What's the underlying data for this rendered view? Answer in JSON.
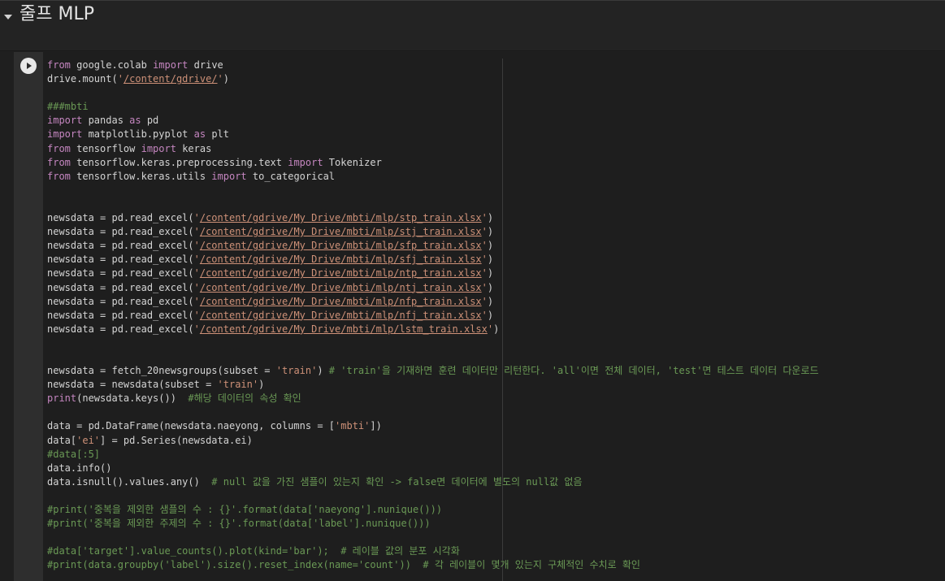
{
  "section": {
    "title": "줄프 MLP",
    "collapse_icon": "caret-down-icon"
  },
  "cell": {
    "run_icon": "play-icon",
    "lines": [
      [
        {
          "t": "kw",
          "v": "from"
        },
        {
          "t": "plain",
          "v": " google.colab "
        },
        {
          "t": "kw",
          "v": "import"
        },
        {
          "t": "plain",
          "v": " drive"
        }
      ],
      [
        {
          "t": "plain",
          "v": "drive.mount("
        },
        {
          "t": "str",
          "v": "'"
        },
        {
          "t": "link",
          "v": "/content/gdrive/"
        },
        {
          "t": "str",
          "v": "'"
        },
        {
          "t": "plain",
          "v": ")"
        }
      ],
      [],
      [
        {
          "t": "cmt",
          "v": "###mbti"
        }
      ],
      [
        {
          "t": "kw",
          "v": "import"
        },
        {
          "t": "plain",
          "v": " pandas "
        },
        {
          "t": "kw",
          "v": "as"
        },
        {
          "t": "plain",
          "v": " pd"
        }
      ],
      [
        {
          "t": "kw",
          "v": "import"
        },
        {
          "t": "plain",
          "v": " matplotlib.pyplot "
        },
        {
          "t": "kw",
          "v": "as"
        },
        {
          "t": "plain",
          "v": " plt"
        }
      ],
      [
        {
          "t": "kw",
          "v": "from"
        },
        {
          "t": "plain",
          "v": " tensorflow "
        },
        {
          "t": "kw",
          "v": "import"
        },
        {
          "t": "plain",
          "v": " keras"
        }
      ],
      [
        {
          "t": "kw",
          "v": "from"
        },
        {
          "t": "plain",
          "v": " tensorflow.keras.preprocessing.text "
        },
        {
          "t": "kw",
          "v": "import"
        },
        {
          "t": "plain",
          "v": " Tokenizer"
        }
      ],
      [
        {
          "t": "kw",
          "v": "from"
        },
        {
          "t": "plain",
          "v": " tensorflow.keras.utils "
        },
        {
          "t": "kw",
          "v": "import"
        },
        {
          "t": "plain",
          "v": " to_categorical"
        }
      ],
      [],
      [],
      [
        {
          "t": "plain",
          "v": "newsdata = pd.read_excel("
        },
        {
          "t": "str",
          "v": "'"
        },
        {
          "t": "link",
          "v": "/content/gdrive/My Drive/mbti/mlp/stp_train.xlsx"
        },
        {
          "t": "str",
          "v": "'"
        },
        {
          "t": "plain",
          "v": ")"
        }
      ],
      [
        {
          "t": "plain",
          "v": "newsdata = pd.read_excel("
        },
        {
          "t": "str",
          "v": "'"
        },
        {
          "t": "link",
          "v": "/content/gdrive/My Drive/mbti/mlp/stj_train.xlsx"
        },
        {
          "t": "str",
          "v": "'"
        },
        {
          "t": "plain",
          "v": ")"
        }
      ],
      [
        {
          "t": "plain",
          "v": "newsdata = pd.read_excel("
        },
        {
          "t": "str",
          "v": "'"
        },
        {
          "t": "link",
          "v": "/content/gdrive/My Drive/mbti/mlp/sfp_train.xlsx"
        },
        {
          "t": "str",
          "v": "'"
        },
        {
          "t": "plain",
          "v": ")"
        }
      ],
      [
        {
          "t": "plain",
          "v": "newsdata = pd.read_excel("
        },
        {
          "t": "str",
          "v": "'"
        },
        {
          "t": "link",
          "v": "/content/gdrive/My Drive/mbti/mlp/sfj_train.xlsx"
        },
        {
          "t": "str",
          "v": "'"
        },
        {
          "t": "plain",
          "v": ")"
        }
      ],
      [
        {
          "t": "plain",
          "v": "newsdata = pd.read_excel("
        },
        {
          "t": "str",
          "v": "'"
        },
        {
          "t": "link",
          "v": "/content/gdrive/My Drive/mbti/mlp/ntp_train.xlsx"
        },
        {
          "t": "str",
          "v": "'"
        },
        {
          "t": "plain",
          "v": ")"
        }
      ],
      [
        {
          "t": "plain",
          "v": "newsdata = pd.read_excel("
        },
        {
          "t": "str",
          "v": "'"
        },
        {
          "t": "link",
          "v": "/content/gdrive/My Drive/mbti/mlp/ntj_train.xlsx"
        },
        {
          "t": "str",
          "v": "'"
        },
        {
          "t": "plain",
          "v": ")"
        }
      ],
      [
        {
          "t": "plain",
          "v": "newsdata = pd.read_excel("
        },
        {
          "t": "str",
          "v": "'"
        },
        {
          "t": "link",
          "v": "/content/gdrive/My Drive/mbti/mlp/nfp_train.xlsx"
        },
        {
          "t": "str",
          "v": "'"
        },
        {
          "t": "plain",
          "v": ")"
        }
      ],
      [
        {
          "t": "plain",
          "v": "newsdata = pd.read_excel("
        },
        {
          "t": "str",
          "v": "'"
        },
        {
          "t": "link",
          "v": "/content/gdrive/My Drive/mbti/mlp/nfj_train.xlsx"
        },
        {
          "t": "str",
          "v": "'"
        },
        {
          "t": "plain",
          "v": ")"
        }
      ],
      [
        {
          "t": "plain",
          "v": "newsdata = pd.read_excel("
        },
        {
          "t": "str",
          "v": "'"
        },
        {
          "t": "link",
          "v": "/content/gdrive/My Drive/mbti/mlp/lstm_train.xlsx"
        },
        {
          "t": "str",
          "v": "'"
        },
        {
          "t": "plain",
          "v": ")"
        }
      ],
      [],
      [],
      [
        {
          "t": "plain",
          "v": "newsdata = fetch_20newsgroups(subset = "
        },
        {
          "t": "str",
          "v": "'train'"
        },
        {
          "t": "plain",
          "v": ") "
        },
        {
          "t": "cmt",
          "v": "# 'train'을 기재하면 훈련 데이터만 리턴한다. 'all'이면 전체 데이터, 'test'면 테스트 데이터 다운로드"
        }
      ],
      [
        {
          "t": "plain",
          "v": "newsdata = newsdata(subset = "
        },
        {
          "t": "str",
          "v": "'train'"
        },
        {
          "t": "plain",
          "v": ")"
        }
      ],
      [
        {
          "t": "kw",
          "v": "print"
        },
        {
          "t": "plain",
          "v": "(newsdata.keys())  "
        },
        {
          "t": "cmt",
          "v": "#해당 데이터의 속성 확인"
        }
      ],
      [],
      [
        {
          "t": "plain",
          "v": "data = pd.DataFrame(newsdata.naeyong, columns = ["
        },
        {
          "t": "str",
          "v": "'mbti'"
        },
        {
          "t": "plain",
          "v": "])"
        }
      ],
      [
        {
          "t": "plain",
          "v": "data["
        },
        {
          "t": "str",
          "v": "'ei'"
        },
        {
          "t": "plain",
          "v": "] = pd.Series(newsdata.ei)"
        }
      ],
      [
        {
          "t": "cmt",
          "v": "#data[:5]"
        }
      ],
      [
        {
          "t": "plain",
          "v": "data.info()"
        }
      ],
      [
        {
          "t": "plain",
          "v": "data.isnull().values.any()  "
        },
        {
          "t": "cmt",
          "v": "# null 값을 가진 샘플이 있는지 확인 -> false면 데이터에 별도의 null값 없음"
        }
      ],
      [],
      [
        {
          "t": "cmt",
          "v": "#print('중복을 제외한 샘플의 수 : {}'.format(data['naeyong'].nunique()))"
        }
      ],
      [
        {
          "t": "cmt",
          "v": "#print('중복을 제외한 주제의 수 : {}'.format(data['label'].nunique()))"
        }
      ],
      [],
      [
        {
          "t": "cmt",
          "v": "#data['target'].value_counts().plot(kind='bar');  # 레이블 값의 분포 시각화"
        }
      ],
      [
        {
          "t": "cmt",
          "v": "#print(data.groupby('label').size().reset_index(name='count'))  # 각 레이블이 몇개 있는지 구체적인 수치로 확인"
        }
      ]
    ]
  }
}
